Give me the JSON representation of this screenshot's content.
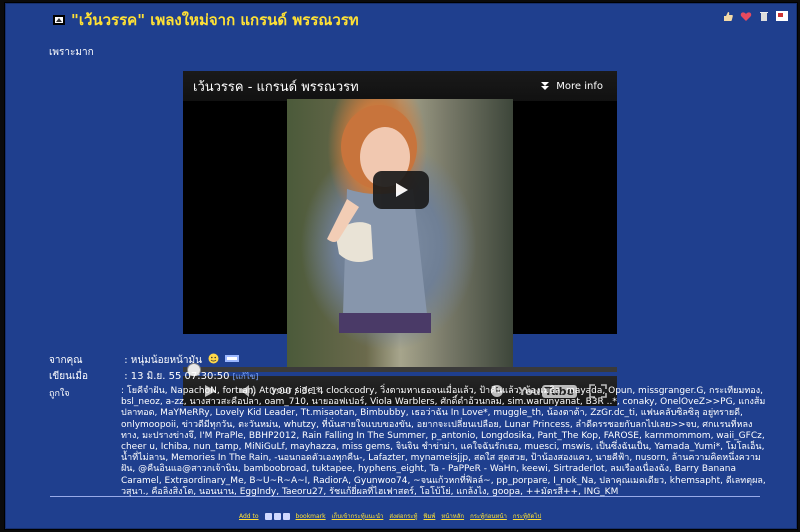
{
  "post": {
    "title": "\"เว้นวรรค\" เพลงใหม่จาก แกรนด์ พรรณวรท",
    "subtitle": "เพราะมาก"
  },
  "video": {
    "title": "เว้นวรรค - แกรนด์ พรรณวรท",
    "more_info_label": "More info",
    "time_display": "0:00 / 3:14",
    "progress": 0.0,
    "logo": {
      "you": "You",
      "tube": "Tube"
    }
  },
  "meta": {
    "from_label": "จากคุณ",
    "from_value": ": หนุ่มน้อยหน้ามัน",
    "date_label": "เขียนเมื่อ",
    "date_value": ": 13 มิ.ย. 55 07:30:50",
    "date_link": "[แก้ไข]",
    "liked_label": "ถูกใจ",
    "liked_value": ": โยคีจำฝัน, NapachoN, fortran, At your side *, clockcodry, วิ่งตามหาเธอจนเมื่อแล้ว, ป้าคืนแล้ว, น้องเมธิล, mayada, Opun, missgranger.G, กระเทียมทอง, bsl_neoz, a-zz, นางสาวสะคือปลา, oam_710, นายออฟเปอร์, Viola Warblers, ศักดิ์ดำอ้วนกลม, sim.warunyanat, B3R ..*, conaky, OnelOveZ>>PG, แกงส้มปลาทอด, MaYMeRRy, Lovely Kid Leader, Tt.misaotan, Bimbubby, เธอว่าฉัน In Love*, muggle_th, น้องตาต้า, ZzGr.dc_ti, แฟนคลับซิลซิลุ อยู่ทรายดี, onlymoopoii, ข่าวดีมีทุกวัน, ตะวันหม่น, whutzy, ที่นั่นสายใจแบบของขัน, อยากจะเปลี่ยนเปลือย, Lunar Princess, ลำดีดรรชอยกับลกไปเลย>>จบ, ศกเเรนที่หลงทาง, มะปรางข่างจึ, I'M PraPle, BBHP2012, Rain Falling In The Summer, p_antonio, Longdosika, Pant_The Kop, FAROSE, karnmommom, waii_GFCz, cheer u, Ichiba, nun_tamp, MiNiGuLf, mayhazza, miss gems, จินจิน ชำข่าม่า, แคใจฉันรักเธอ, muesci, mswis, เป็นซึ่งฉันเป็น, Yamada_Yumi*, โมโลเอ็น, น้ำที่ไม่ลาน, Memories In The Rain, -นอนกอดตัวเองทุกคืน-, Lafazter, mynameisjjp, สดใส สุดสวย, ป้าน้องสองแคว, นายคีฟ้า, nusorn, ล้านความคิดหนึ่งความฝัน, @คืนอินแอ@สาวกเจ้านิน, bamboobroad, tuktapee, hyphens_eight, Ta - PaPPeR - WaHn, keewi, Sirtraderlot, ลมเรืองเนื่องฉัง, Barry Banana Caramel, Extraordinary_Me, B~U~R~A~I, RadiorA, Gyunwoo74, ~จนแก้วหกที่ฟิลล์~, pp_porpare, I_nok_Na, ปลาคุณเมดเดียว, khemsapht, ดีเลทตุผล, วสุนา., คือลิงสิงโต, นอนนาน, EggIndy, Taeoru27, รัชแก้ยี่ผลที่ไฮเฟาสตร์, โอโบ้โย่, แกล้งไง, goopa, ++มัดรสี++, ING_KM"
  },
  "footer": {
    "add_to_label": "Add to",
    "links": [
      "bookmark",
      "เก็บเข้ากระทู้แนะนำ",
      "ส่งต่อกระทู้",
      "พิมพ์",
      "หน้าหลัก",
      "กระทู้ก่อนหน้า",
      "กระทู้ถัดไป"
    ]
  },
  "colors": {
    "page_background": "#1f3f8e",
    "title": "#ffe135",
    "link": "#7ea8ff"
  }
}
